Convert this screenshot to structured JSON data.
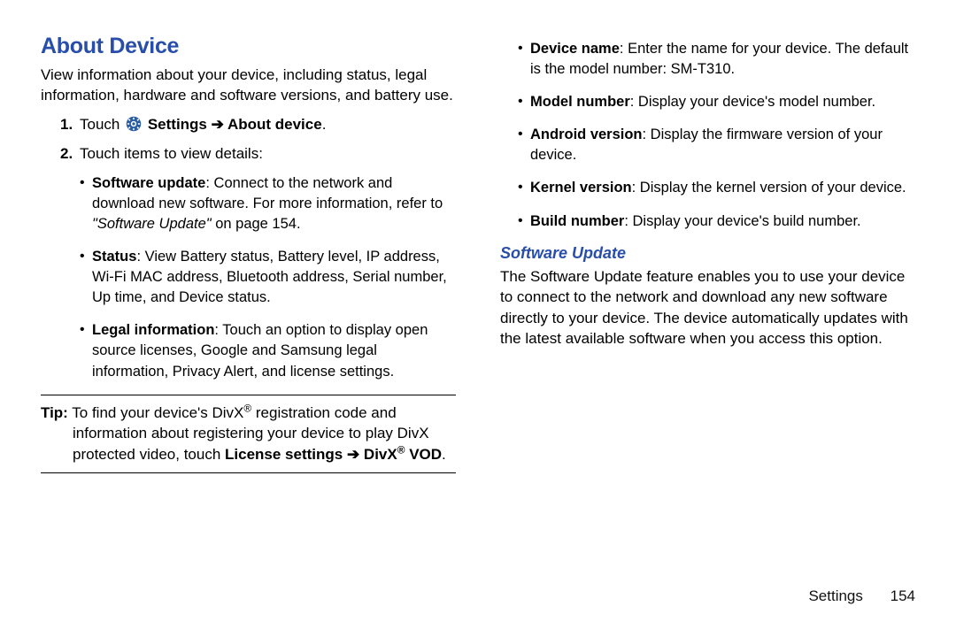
{
  "left": {
    "title": "About Device",
    "intro": "View information about your device, including status, legal information, hardware and software versions, and battery use.",
    "step1_prefix": "Touch ",
    "step1_bold": " Settings ➔ About device",
    "step1_suffix": ".",
    "step2": "Touch items to view details:",
    "b1_label": "Software update",
    "b1_text1": ": Connect to the network and download new software. For more information, refer to ",
    "b1_italic": "\"Software Update\"",
    "b1_text2": " on page 154.",
    "b2_label": "Status",
    "b2_text": ": View Battery status, Battery level, IP address, Wi-Fi MAC address, Bluetooth address, Serial number, Up time, and Device status.",
    "b3_label": "Legal information",
    "b3_text": ": Touch an option to display open source licenses, Google and Samsung legal information, Privacy Alert, and license settings.",
    "tip_label": "Tip:",
    "tip_l1a": " To find your device's DivX",
    "tip_l1b": " registration code and",
    "tip_l2": "information about registering your device to play DivX",
    "tip_l3a": "protected video, touch ",
    "tip_bold1": "License settings ➔ DivX",
    "tip_bold2": " VOD",
    "tip_l3end": "."
  },
  "right": {
    "r1_label": "Device name",
    "r1_text": ": Enter the name for your device. The default is the model number: SM-T310.",
    "r2_label": "Model number",
    "r2_text": ": Display your device's model number.",
    "r3_label": "Android version",
    "r3_text": ": Display the firmware version of your device.",
    "r4_label": "Kernel version",
    "r4_text": ": Display the kernel version of your device.",
    "r5_label": "Build number",
    "r5_text": ": Display your device's build number.",
    "sub_title": "Software Update",
    "sub_body": "The Software Update feature enables you to use your device to connect to the network and download any new software directly to your device. The device automatically updates with the latest available software when you access this option."
  },
  "footer": {
    "chapter": "Settings",
    "page": "154"
  }
}
